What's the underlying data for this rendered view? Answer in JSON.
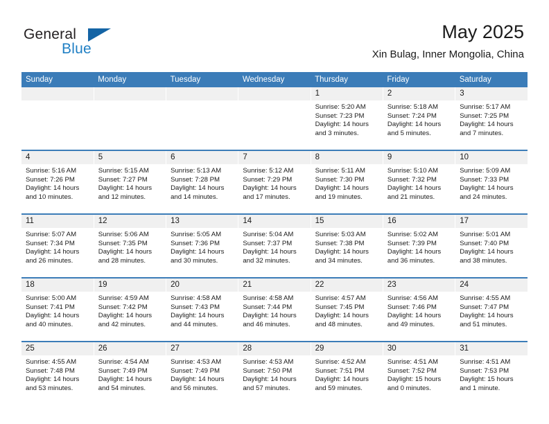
{
  "brand": {
    "word_general": "General",
    "word_blue": "Blue",
    "flag_icon": "brand-triangle-icon"
  },
  "header": {
    "title": "May 2025",
    "subtitle": "Xin Bulag, Inner Mongolia, China"
  },
  "colors": {
    "header_blue": "#3b7cb8",
    "brand_blue": "#1f7fc4",
    "flag_blue": "#1464a5",
    "daynum_strip": "#f0f0f0",
    "text": "#1a1a1a"
  },
  "weekdays": [
    "Sunday",
    "Monday",
    "Tuesday",
    "Wednesday",
    "Thursday",
    "Friday",
    "Saturday"
  ],
  "weeks": [
    [
      {
        "day": "",
        "lines": []
      },
      {
        "day": "",
        "lines": []
      },
      {
        "day": "",
        "lines": []
      },
      {
        "day": "",
        "lines": []
      },
      {
        "day": "1",
        "lines": [
          "Sunrise: 5:20 AM",
          "Sunset: 7:23 PM",
          "Daylight: 14 hours",
          "and 3 minutes."
        ]
      },
      {
        "day": "2",
        "lines": [
          "Sunrise: 5:18 AM",
          "Sunset: 7:24 PM",
          "Daylight: 14 hours",
          "and 5 minutes."
        ]
      },
      {
        "day": "3",
        "lines": [
          "Sunrise: 5:17 AM",
          "Sunset: 7:25 PM",
          "Daylight: 14 hours",
          "and 7 minutes."
        ]
      }
    ],
    [
      {
        "day": "4",
        "lines": [
          "Sunrise: 5:16 AM",
          "Sunset: 7:26 PM",
          "Daylight: 14 hours",
          "and 10 minutes."
        ]
      },
      {
        "day": "5",
        "lines": [
          "Sunrise: 5:15 AM",
          "Sunset: 7:27 PM",
          "Daylight: 14 hours",
          "and 12 minutes."
        ]
      },
      {
        "day": "6",
        "lines": [
          "Sunrise: 5:13 AM",
          "Sunset: 7:28 PM",
          "Daylight: 14 hours",
          "and 14 minutes."
        ]
      },
      {
        "day": "7",
        "lines": [
          "Sunrise: 5:12 AM",
          "Sunset: 7:29 PM",
          "Daylight: 14 hours",
          "and 17 minutes."
        ]
      },
      {
        "day": "8",
        "lines": [
          "Sunrise: 5:11 AM",
          "Sunset: 7:30 PM",
          "Daylight: 14 hours",
          "and 19 minutes."
        ]
      },
      {
        "day": "9",
        "lines": [
          "Sunrise: 5:10 AM",
          "Sunset: 7:32 PM",
          "Daylight: 14 hours",
          "and 21 minutes."
        ]
      },
      {
        "day": "10",
        "lines": [
          "Sunrise: 5:09 AM",
          "Sunset: 7:33 PM",
          "Daylight: 14 hours",
          "and 24 minutes."
        ]
      }
    ],
    [
      {
        "day": "11",
        "lines": [
          "Sunrise: 5:07 AM",
          "Sunset: 7:34 PM",
          "Daylight: 14 hours",
          "and 26 minutes."
        ]
      },
      {
        "day": "12",
        "lines": [
          "Sunrise: 5:06 AM",
          "Sunset: 7:35 PM",
          "Daylight: 14 hours",
          "and 28 minutes."
        ]
      },
      {
        "day": "13",
        "lines": [
          "Sunrise: 5:05 AM",
          "Sunset: 7:36 PM",
          "Daylight: 14 hours",
          "and 30 minutes."
        ]
      },
      {
        "day": "14",
        "lines": [
          "Sunrise: 5:04 AM",
          "Sunset: 7:37 PM",
          "Daylight: 14 hours",
          "and 32 minutes."
        ]
      },
      {
        "day": "15",
        "lines": [
          "Sunrise: 5:03 AM",
          "Sunset: 7:38 PM",
          "Daylight: 14 hours",
          "and 34 minutes."
        ]
      },
      {
        "day": "16",
        "lines": [
          "Sunrise: 5:02 AM",
          "Sunset: 7:39 PM",
          "Daylight: 14 hours",
          "and 36 minutes."
        ]
      },
      {
        "day": "17",
        "lines": [
          "Sunrise: 5:01 AM",
          "Sunset: 7:40 PM",
          "Daylight: 14 hours",
          "and 38 minutes."
        ]
      }
    ],
    [
      {
        "day": "18",
        "lines": [
          "Sunrise: 5:00 AM",
          "Sunset: 7:41 PM",
          "Daylight: 14 hours",
          "and 40 minutes."
        ]
      },
      {
        "day": "19",
        "lines": [
          "Sunrise: 4:59 AM",
          "Sunset: 7:42 PM",
          "Daylight: 14 hours",
          "and 42 minutes."
        ]
      },
      {
        "day": "20",
        "lines": [
          "Sunrise: 4:58 AM",
          "Sunset: 7:43 PM",
          "Daylight: 14 hours",
          "and 44 minutes."
        ]
      },
      {
        "day": "21",
        "lines": [
          "Sunrise: 4:58 AM",
          "Sunset: 7:44 PM",
          "Daylight: 14 hours",
          "and 46 minutes."
        ]
      },
      {
        "day": "22",
        "lines": [
          "Sunrise: 4:57 AM",
          "Sunset: 7:45 PM",
          "Daylight: 14 hours",
          "and 48 minutes."
        ]
      },
      {
        "day": "23",
        "lines": [
          "Sunrise: 4:56 AM",
          "Sunset: 7:46 PM",
          "Daylight: 14 hours",
          "and 49 minutes."
        ]
      },
      {
        "day": "24",
        "lines": [
          "Sunrise: 4:55 AM",
          "Sunset: 7:47 PM",
          "Daylight: 14 hours",
          "and 51 minutes."
        ]
      }
    ],
    [
      {
        "day": "25",
        "lines": [
          "Sunrise: 4:55 AM",
          "Sunset: 7:48 PM",
          "Daylight: 14 hours",
          "and 53 minutes."
        ]
      },
      {
        "day": "26",
        "lines": [
          "Sunrise: 4:54 AM",
          "Sunset: 7:49 PM",
          "Daylight: 14 hours",
          "and 54 minutes."
        ]
      },
      {
        "day": "27",
        "lines": [
          "Sunrise: 4:53 AM",
          "Sunset: 7:49 PM",
          "Daylight: 14 hours",
          "and 56 minutes."
        ]
      },
      {
        "day": "28",
        "lines": [
          "Sunrise: 4:53 AM",
          "Sunset: 7:50 PM",
          "Daylight: 14 hours",
          "and 57 minutes."
        ]
      },
      {
        "day": "29",
        "lines": [
          "Sunrise: 4:52 AM",
          "Sunset: 7:51 PM",
          "Daylight: 14 hours",
          "and 59 minutes."
        ]
      },
      {
        "day": "30",
        "lines": [
          "Sunrise: 4:51 AM",
          "Sunset: 7:52 PM",
          "Daylight: 15 hours",
          "and 0 minutes."
        ]
      },
      {
        "day": "31",
        "lines": [
          "Sunrise: 4:51 AM",
          "Sunset: 7:53 PM",
          "Daylight: 15 hours",
          "and 1 minute."
        ]
      }
    ]
  ]
}
